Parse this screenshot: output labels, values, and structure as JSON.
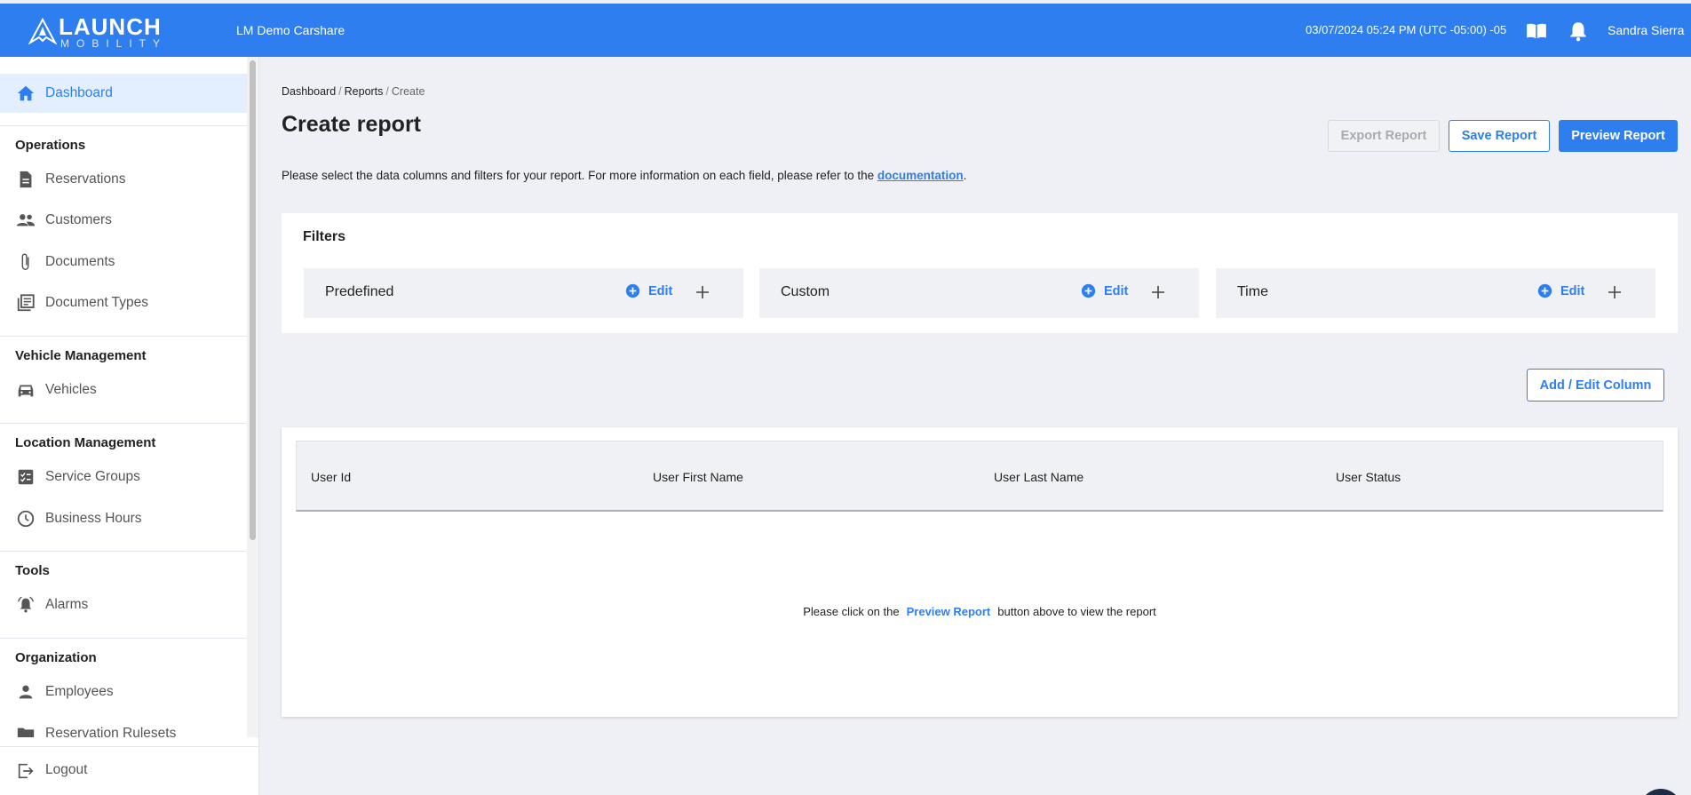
{
  "header": {
    "logo_text": "LAUNCH",
    "logo_subtext": "MOBILITY",
    "company": "LM Demo Carshare",
    "datetime": "03/07/2024 05:24 PM (UTC -05:00) -05",
    "user": "Sandra Sierra",
    "colors": {
      "brand": "#2f7ef0"
    }
  },
  "sidebar": {
    "dashboard": "Dashboard",
    "sections": {
      "operations": "Operations",
      "vehicle_management": "Vehicle Management",
      "location_management": "Location Management",
      "tools": "Tools",
      "organization": "Organization"
    },
    "items": {
      "reservations": "Reservations",
      "customers": "Customers",
      "documents": "Documents",
      "document_types": "Document Types",
      "vehicles": "Vehicles",
      "service_groups": "Service Groups",
      "business_hours": "Business Hours",
      "alarms": "Alarms",
      "employees": "Employees",
      "reservation_rulesets": "Reservation Rulesets"
    },
    "logout": "Logout"
  },
  "breadcrumb": {
    "dashboard": "Dashboard",
    "reports": "Reports",
    "current": "Create"
  },
  "page": {
    "title": "Create report",
    "intro_before": "Please select the data columns and filters for your report. For more information on each field, please refer to the ",
    "intro_link": "documentation",
    "intro_after": "."
  },
  "actions": {
    "export": "Export Report",
    "save": "Save Report",
    "preview": "Preview Report"
  },
  "filters": {
    "title": "Filters",
    "edit_label": "Edit",
    "groups": [
      "Predefined",
      "Custom",
      "Time"
    ]
  },
  "columns": {
    "add_edit_label": "Add / Edit Column",
    "headers": [
      "User Id",
      "User First Name",
      "User Last Name",
      "User Status"
    ]
  },
  "empty_state": {
    "before": "Please click on the",
    "link": "Preview Report",
    "after": "button above to view the report"
  }
}
